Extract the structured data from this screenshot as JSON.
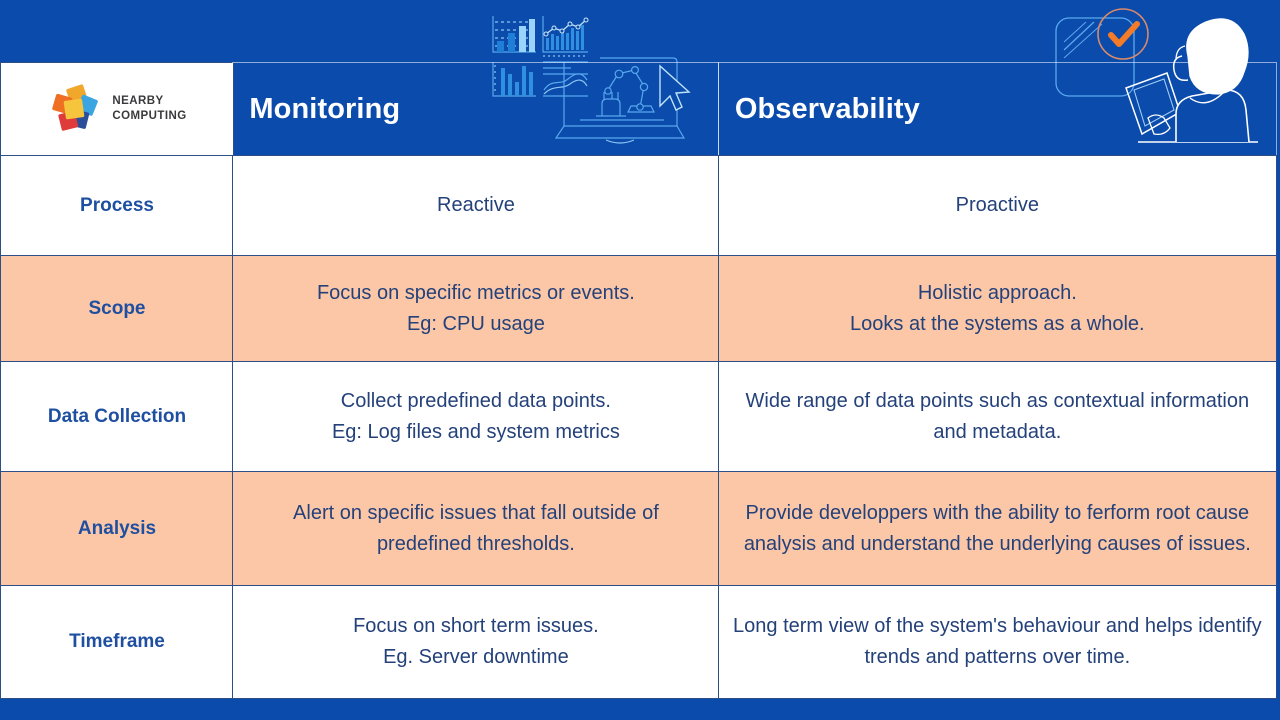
{
  "brand": {
    "name_line1": "NEARBY",
    "name_line2": "COMPUTING",
    "logo_icon": "nearby-computing-pinwheel-logo"
  },
  "theme": {
    "header_blue": "#0a4bab",
    "table_border": "#2e4f86",
    "label_blue": "#1f4fa0",
    "value_blue": "#24417a",
    "row_peach": "#fbc7a7",
    "row_white": "#ffffff",
    "accent_orange": "#f47b28"
  },
  "header": {
    "col_label": "",
    "col_monitoring": "Monitoring",
    "col_observability": "Observability",
    "illustration_left": "analytics-dashboard-laptop-robot-arm-icon",
    "illustration_right": "person-tablet-checkmark-icon"
  },
  "table": {
    "columns": [
      "",
      "Monitoring",
      "Observability"
    ],
    "rows": [
      {
        "label": "Process",
        "monitoring": "Reactive",
        "observability": "Proactive",
        "shade": "white"
      },
      {
        "label": "Scope",
        "monitoring": "Focus on specific metrics or events.\nEg: CPU usage",
        "observability": "Holistic approach.\nLooks at the systems as a whole.",
        "shade": "peach"
      },
      {
        "label": "Data Collection",
        "monitoring": "Collect predefined data points.\nEg: Log files and system metrics",
        "observability": "Wide range of data points such as contextual information and metadata.",
        "shade": "white"
      },
      {
        "label": "Analysis",
        "monitoring": "Alert on specific issues that fall outside of predefined thresholds.",
        "observability": "Provide developpers with the ability to ferform root cause analysis and understand the underlying causes of issues.",
        "shade": "peach"
      },
      {
        "label": "Timeframe",
        "monitoring": "Focus on short term issues.\nEg. Server downtime",
        "observability": "Long term view of the system's behaviour and helps identify trends and patterns over time.",
        "shade": "white"
      }
    ]
  }
}
